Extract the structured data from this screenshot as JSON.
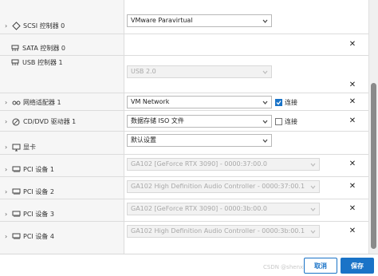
{
  "rows": [
    {
      "label": "SCSI 控制器 0",
      "value": "VMware Paravirtual",
      "icon": "scsi-icon"
    },
    {
      "label": "SATA 控制器 0",
      "icon": "sata-icon"
    },
    {
      "label": "USB 控制器 1",
      "value": "USB 2.0",
      "icon": "usb-icon"
    },
    {
      "label": "网络适配器 1",
      "value": "VM Network",
      "checkbox": "连接",
      "checked": true,
      "icon": "network-adapter-icon"
    },
    {
      "label": "CD/DVD 驱动器 1",
      "value": "数据存储 ISO 文件",
      "checkbox": "连接",
      "checked": false,
      "icon": "cd-dvd-icon"
    },
    {
      "label": "显卡",
      "value": "默认设置",
      "icon": "display-icon"
    },
    {
      "label": "PCI 设备 1",
      "value": "GA102 [GeForce RTX 3090] - 0000:37:00.0",
      "icon": "pci-icon"
    },
    {
      "label": "PCI 设备 2",
      "value": "GA102 High Definition Audio Controller - 0000:37:00.1",
      "icon": "pci-icon"
    },
    {
      "label": "PCI 设备 3",
      "value": "GA102 [GeForce RTX 3090] - 0000:3b:00.0",
      "icon": "pci-icon"
    },
    {
      "label": "PCI 设备 4",
      "value": "GA102 High Definition Audio Controller - 0000:3b:00.1",
      "icon": "pci-icon"
    }
  ],
  "footer": {
    "cancel": "取消",
    "save": "保存",
    "watermark": "CSDN @shenxian"
  },
  "colors": {
    "accent": "#1a73c7"
  }
}
